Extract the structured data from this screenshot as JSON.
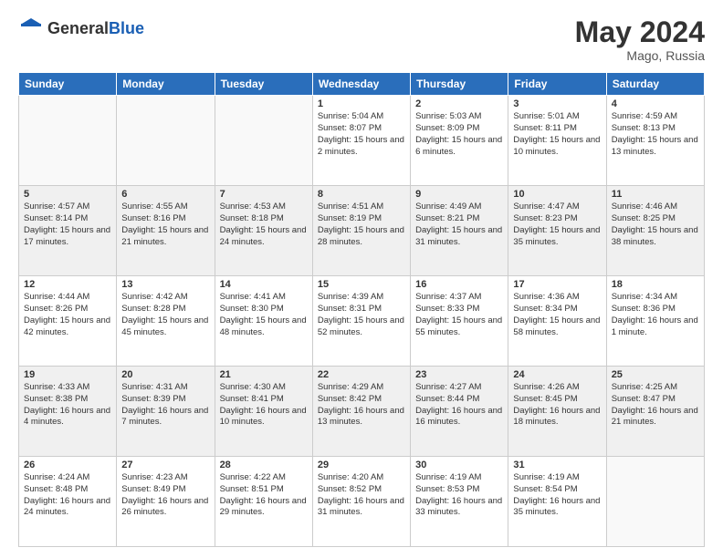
{
  "header": {
    "logo_general": "General",
    "logo_blue": "Blue",
    "month_year": "May 2024",
    "location": "Mago, Russia"
  },
  "weekdays": [
    "Sunday",
    "Monday",
    "Tuesday",
    "Wednesday",
    "Thursday",
    "Friday",
    "Saturday"
  ],
  "weeks": [
    [
      {
        "day": "",
        "info": ""
      },
      {
        "day": "",
        "info": ""
      },
      {
        "day": "",
        "info": ""
      },
      {
        "day": "1",
        "info": "Sunrise: 5:04 AM\nSunset: 8:07 PM\nDaylight: 15 hours and 2 minutes."
      },
      {
        "day": "2",
        "info": "Sunrise: 5:03 AM\nSunset: 8:09 PM\nDaylight: 15 hours and 6 minutes."
      },
      {
        "day": "3",
        "info": "Sunrise: 5:01 AM\nSunset: 8:11 PM\nDaylight: 15 hours and 10 minutes."
      },
      {
        "day": "4",
        "info": "Sunrise: 4:59 AM\nSunset: 8:13 PM\nDaylight: 15 hours and 13 minutes."
      }
    ],
    [
      {
        "day": "5",
        "info": "Sunrise: 4:57 AM\nSunset: 8:14 PM\nDaylight: 15 hours and 17 minutes."
      },
      {
        "day": "6",
        "info": "Sunrise: 4:55 AM\nSunset: 8:16 PM\nDaylight: 15 hours and 21 minutes."
      },
      {
        "day": "7",
        "info": "Sunrise: 4:53 AM\nSunset: 8:18 PM\nDaylight: 15 hours and 24 minutes."
      },
      {
        "day": "8",
        "info": "Sunrise: 4:51 AM\nSunset: 8:19 PM\nDaylight: 15 hours and 28 minutes."
      },
      {
        "day": "9",
        "info": "Sunrise: 4:49 AM\nSunset: 8:21 PM\nDaylight: 15 hours and 31 minutes."
      },
      {
        "day": "10",
        "info": "Sunrise: 4:47 AM\nSunset: 8:23 PM\nDaylight: 15 hours and 35 minutes."
      },
      {
        "day": "11",
        "info": "Sunrise: 4:46 AM\nSunset: 8:25 PM\nDaylight: 15 hours and 38 minutes."
      }
    ],
    [
      {
        "day": "12",
        "info": "Sunrise: 4:44 AM\nSunset: 8:26 PM\nDaylight: 15 hours and 42 minutes."
      },
      {
        "day": "13",
        "info": "Sunrise: 4:42 AM\nSunset: 8:28 PM\nDaylight: 15 hours and 45 minutes."
      },
      {
        "day": "14",
        "info": "Sunrise: 4:41 AM\nSunset: 8:30 PM\nDaylight: 15 hours and 48 minutes."
      },
      {
        "day": "15",
        "info": "Sunrise: 4:39 AM\nSunset: 8:31 PM\nDaylight: 15 hours and 52 minutes."
      },
      {
        "day": "16",
        "info": "Sunrise: 4:37 AM\nSunset: 8:33 PM\nDaylight: 15 hours and 55 minutes."
      },
      {
        "day": "17",
        "info": "Sunrise: 4:36 AM\nSunset: 8:34 PM\nDaylight: 15 hours and 58 minutes."
      },
      {
        "day": "18",
        "info": "Sunrise: 4:34 AM\nSunset: 8:36 PM\nDaylight: 16 hours and 1 minute."
      }
    ],
    [
      {
        "day": "19",
        "info": "Sunrise: 4:33 AM\nSunset: 8:38 PM\nDaylight: 16 hours and 4 minutes."
      },
      {
        "day": "20",
        "info": "Sunrise: 4:31 AM\nSunset: 8:39 PM\nDaylight: 16 hours and 7 minutes."
      },
      {
        "day": "21",
        "info": "Sunrise: 4:30 AM\nSunset: 8:41 PM\nDaylight: 16 hours and 10 minutes."
      },
      {
        "day": "22",
        "info": "Sunrise: 4:29 AM\nSunset: 8:42 PM\nDaylight: 16 hours and 13 minutes."
      },
      {
        "day": "23",
        "info": "Sunrise: 4:27 AM\nSunset: 8:44 PM\nDaylight: 16 hours and 16 minutes."
      },
      {
        "day": "24",
        "info": "Sunrise: 4:26 AM\nSunset: 8:45 PM\nDaylight: 16 hours and 18 minutes."
      },
      {
        "day": "25",
        "info": "Sunrise: 4:25 AM\nSunset: 8:47 PM\nDaylight: 16 hours and 21 minutes."
      }
    ],
    [
      {
        "day": "26",
        "info": "Sunrise: 4:24 AM\nSunset: 8:48 PM\nDaylight: 16 hours and 24 minutes."
      },
      {
        "day": "27",
        "info": "Sunrise: 4:23 AM\nSunset: 8:49 PM\nDaylight: 16 hours and 26 minutes."
      },
      {
        "day": "28",
        "info": "Sunrise: 4:22 AM\nSunset: 8:51 PM\nDaylight: 16 hours and 29 minutes."
      },
      {
        "day": "29",
        "info": "Sunrise: 4:20 AM\nSunset: 8:52 PM\nDaylight: 16 hours and 31 minutes."
      },
      {
        "day": "30",
        "info": "Sunrise: 4:19 AM\nSunset: 8:53 PM\nDaylight: 16 hours and 33 minutes."
      },
      {
        "day": "31",
        "info": "Sunrise: 4:19 AM\nSunset: 8:54 PM\nDaylight: 16 hours and 35 minutes."
      },
      {
        "day": "",
        "info": ""
      }
    ]
  ]
}
